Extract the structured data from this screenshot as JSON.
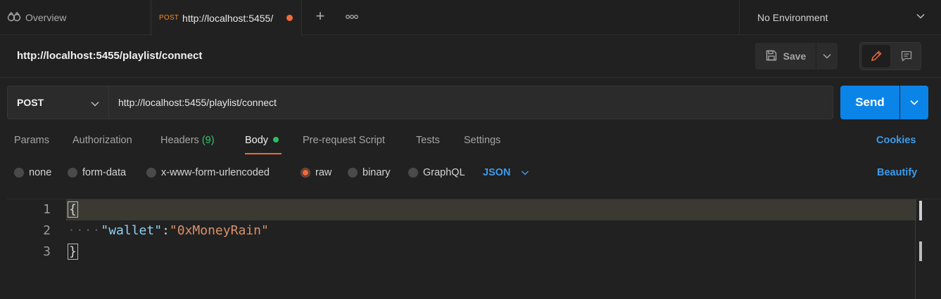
{
  "tabs": {
    "overview_label": "Overview",
    "active": {
      "method": "POST",
      "url": "http://localhost:5455/"
    },
    "new_tab_symbol": "+",
    "more_symbol": "ooo"
  },
  "environment": {
    "label": "No Environment"
  },
  "request": {
    "title": "http://localhost:5455/playlist/connect",
    "save_label": "Save",
    "method": "POST",
    "url": "http://localhost:5455/playlist/connect",
    "send_label": "Send"
  },
  "request_tabs": {
    "params": "Params",
    "authorization": "Authorization",
    "headers": "Headers",
    "headers_count": "(9)",
    "body": "Body",
    "pre_request": "Pre-request Script",
    "tests": "Tests",
    "settings": "Settings",
    "cookies": "Cookies"
  },
  "body_types": {
    "none": "none",
    "form_data": "form-data",
    "urlencoded": "x-www-form-urlencoded",
    "raw": "raw",
    "binary": "binary",
    "graphql": "GraphQL",
    "selected": "raw",
    "format": "JSON",
    "beautify": "Beautify"
  },
  "editor": {
    "line_numbers": [
      "1",
      "2",
      "3"
    ],
    "lines": {
      "open": "{",
      "indent": "····",
      "key": "\"wallet\"",
      "colon": ":",
      "value": "\"0xMoneyRain\"",
      "close": "}"
    }
  },
  "colors": {
    "accent_orange": "#ef6a3c",
    "send_blue": "#0b84e8",
    "link_blue": "#3d9be9",
    "success_green": "#2bbf62"
  }
}
